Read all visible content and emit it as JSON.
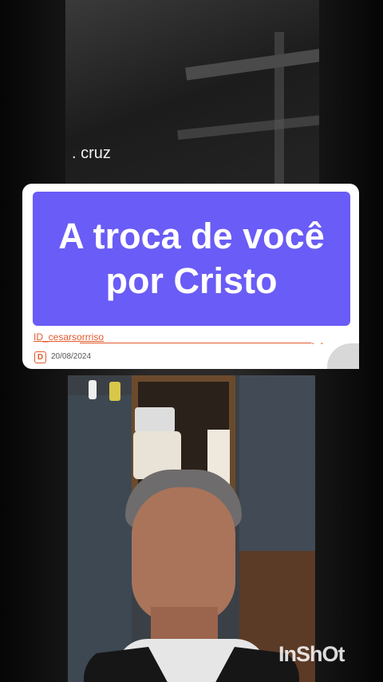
{
  "top_video": {
    "caption": ". cruz"
  },
  "card": {
    "title": "A troca de você\npor Cristo",
    "id_text": "ID_cesarsorrriso",
    "dots": "- -",
    "date_icon_letter": "D",
    "date": "20/08/2024",
    "title_bg_color": "#6a5cf6",
    "accent_color": "#e25a2c"
  },
  "bottom_video": {
    "description_icon": "person-video-icon"
  },
  "watermark": {
    "text": "InShOt"
  }
}
